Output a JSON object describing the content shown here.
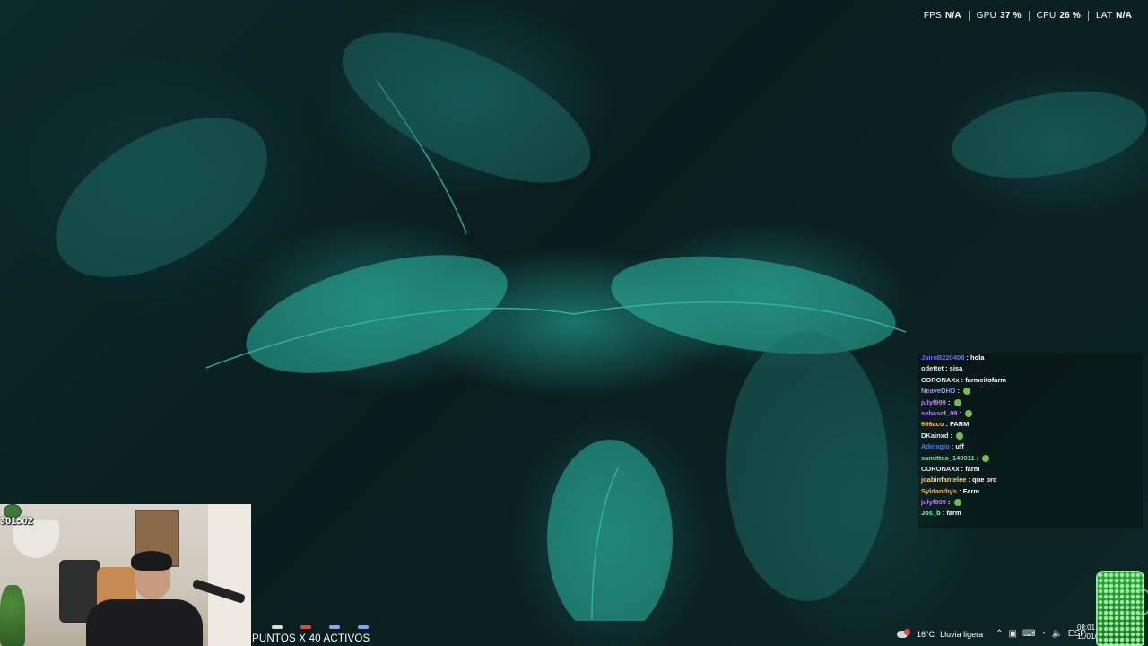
{
  "perf_overlay": {
    "metrics": [
      {
        "label": "FPS",
        "value": "N/A"
      },
      {
        "label": "GPU",
        "value": "37 %"
      },
      {
        "label": "CPU",
        "value": "26 %"
      },
      {
        "label": "LAT",
        "value": "N/A"
      }
    ]
  },
  "chat": {
    "messages": [
      {
        "user": "JairoB220408",
        "text": "hola",
        "color": "#6f6fff",
        "emote": false
      },
      {
        "user": "odettet",
        "text": "sisa",
        "color": "#e8e8e8",
        "emote": false
      },
      {
        "user": "CORONAXx",
        "text": "farmeitofarm",
        "color": "#e8e8e8",
        "emote": false
      },
      {
        "user": "NeaveDHD",
        "text": "",
        "color": "#8aa0ff",
        "emote": true
      },
      {
        "user": "julyf999",
        "text": "",
        "color": "#c77dff",
        "emote": true
      },
      {
        "user": "sebascf_09",
        "text": "",
        "color": "#c77dff",
        "emote": true
      },
      {
        "user": "666aco",
        "text": "FARM",
        "color": "#ffb347",
        "emote": false
      },
      {
        "user": "DKainxd",
        "text": "",
        "color": "#e8e8e8",
        "emote": true
      },
      {
        "user": "Adeisgio",
        "text": "uff",
        "color": "#4a7bff",
        "emote": false
      },
      {
        "user": "samitteo_140911",
        "text": "",
        "color": "#7cd9a6",
        "emote": true
      },
      {
        "user": "CORONAXx",
        "text": "farm",
        "color": "#e8e8e8",
        "emote": false
      },
      {
        "user": "joabinfantelee",
        "text": "que pro",
        "color": "#ffd27a",
        "emote": false
      },
      {
        "user": "Syldanthys",
        "text": "Farm",
        "color": "#ffb347",
        "emote": false
      },
      {
        "user": "julyf999",
        "text": "",
        "color": "#c77dff",
        "emote": true
      },
      {
        "user": "Jos_b",
        "text": "farm",
        "color": "#7cffb0",
        "emote": false
      }
    ]
  },
  "webcam": {
    "counter": "301502"
  },
  "points_banner": "PUNTOS X 40 ACTIVOS",
  "taskbar": {
    "app_colors": [
      "#dddddd",
      "#e04a3a",
      "#8aa8ff",
      "#7aa7ff"
    ],
    "weather": {
      "temp": "16°C",
      "condition": "Lluvia ligera"
    },
    "language": "ESP",
    "time": "08:01",
    "date": "11/01/"
  }
}
